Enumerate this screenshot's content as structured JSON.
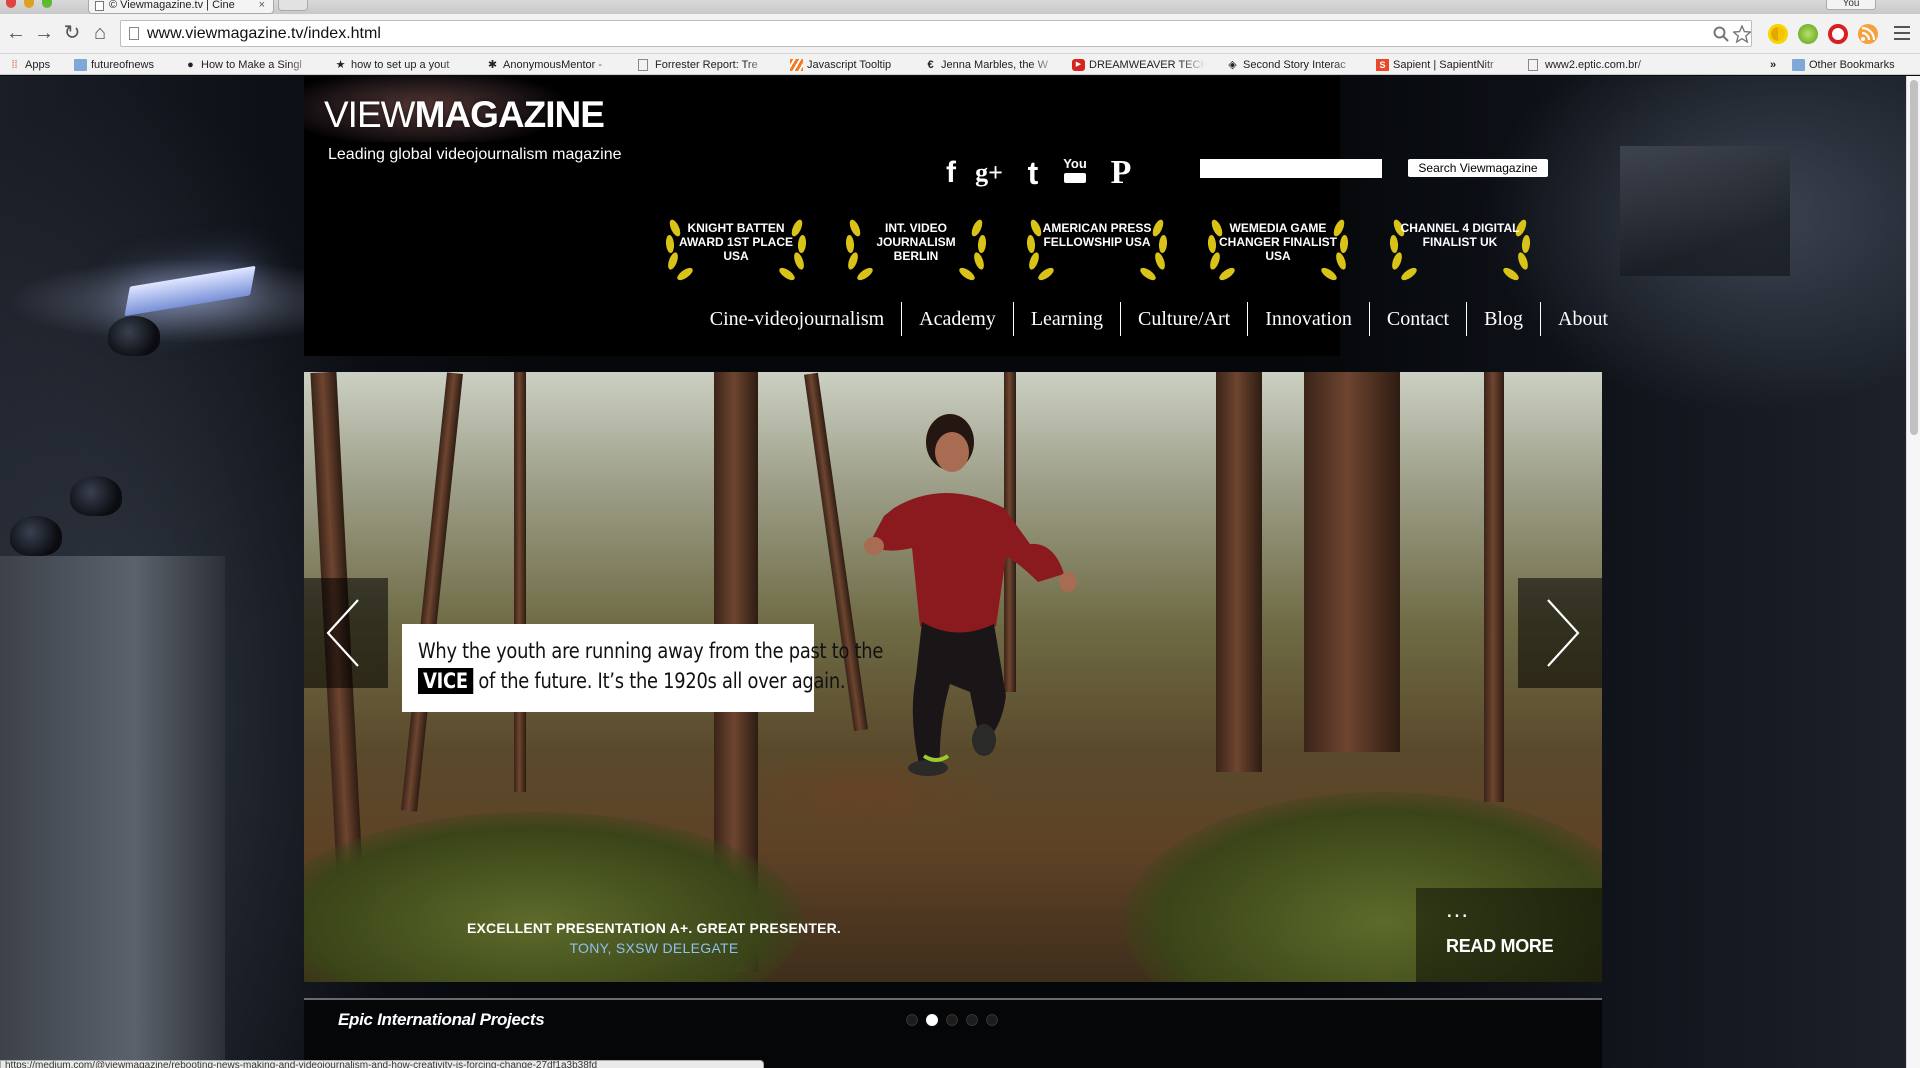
{
  "browser": {
    "tab_title": "© Viewmagazine.tv | Cine",
    "tab_close": "×",
    "profile_label": "You",
    "url": "www.viewmagazine.tv/index.html",
    "nav_icons": {
      "back": "←",
      "forward": "→",
      "reload": "↻",
      "home": "⌂"
    },
    "bookmarks": [
      {
        "label": "Apps",
        "icon": "apps-grid-icon"
      },
      {
        "label": "futureofnews",
        "icon": "folder-icon"
      },
      {
        "label": "How to Make a Singl",
        "icon": "record-icon"
      },
      {
        "label": "how to set up a yout",
        "icon": "star-icon"
      },
      {
        "label": "AnonymousMentor -",
        "icon": "mentor-icon"
      },
      {
        "label": "Forrester Report: Tre",
        "icon": "page-icon"
      },
      {
        "label": "Javascript Tooltip",
        "icon": "stripes-icon"
      },
      {
        "label": "Jenna Marbles, the W",
        "icon": "e-icon"
      },
      {
        "label": "DREAMWEAVER TECH",
        "icon": "youtube-icon"
      },
      {
        "label": "Second Story Interac",
        "icon": "cube-icon"
      },
      {
        "label": "Sapient | SapientNitr",
        "icon": "sapient-icon"
      },
      {
        "label": "www2.eptic.com.br/",
        "icon": "page-icon"
      }
    ],
    "bookmarks_overflow": "»",
    "other_bookmarks": "Other Bookmarks",
    "status_url": "https://medium.com/@viewmagazine/rebooting-news-making-and-videojournalism-and-how-creativity-is-forcing-change-27df1a3b38fd"
  },
  "site": {
    "logo_thin": "VIEW",
    "logo_bold": "MAGAZINE",
    "tagline": "Leading global videojournalism  magazine",
    "social": [
      {
        "name": "facebook-icon",
        "glyph": "f"
      },
      {
        "name": "google-plus-icon",
        "glyph": "g+"
      },
      {
        "name": "twitter-icon",
        "glyph": "t"
      },
      {
        "name": "youtube-icon",
        "glyph": "You"
      },
      {
        "name": "pinterest-icon",
        "glyph": "P"
      }
    ],
    "search_button": "Search Viewmagazine",
    "awards": [
      {
        "text": "KNIGHT BATTEN AWARD 1st PLACE USA"
      },
      {
        "text": "INT. VIDEO JOURNALISM BERLIN"
      },
      {
        "text": "AMERICAN PRESS FELLOWSHIP USA"
      },
      {
        "text": "WEMEDIA GAME CHANGER FINALIST USA"
      },
      {
        "text": "CHANNEL 4 DIGITAL FINALIST UK"
      }
    ],
    "nav": [
      "Cine-videojournalism",
      "Academy",
      "Learning",
      "Culture/Art",
      "Innovation",
      "Contact",
      "Blog",
      "About"
    ],
    "hero": {
      "caption_line1": "Why the youth are running away from the past to the",
      "caption_badge": "VICE",
      "caption_line2": " of the future. It’s the 1920s all over again.",
      "read_more_dots": "...",
      "read_more": "READ MORE",
      "testimonial_quote": "EXCELLENT PRESENTATION A+. GREAT PRESENTER.",
      "testimonial_author": "TONY, SXSW DELEGATE",
      "slide_count": 5,
      "active_slide": 2
    },
    "footer_title": "Epic International Projects"
  }
}
